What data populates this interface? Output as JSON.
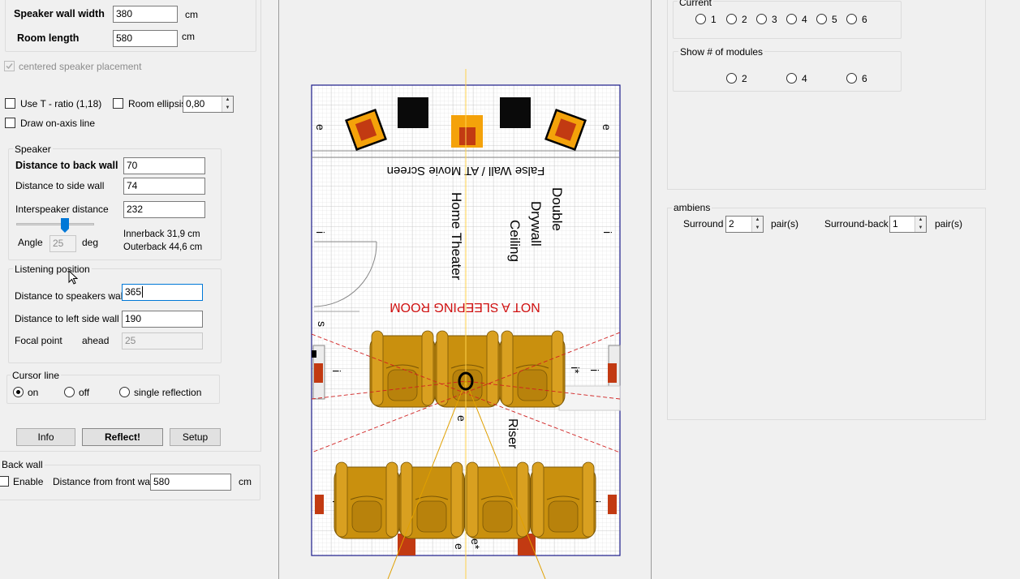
{
  "room": {
    "speaker_wall_width_label": "Speaker wall width",
    "speaker_wall_width_value": "380",
    "room_length_label": "Room length",
    "room_length_value": "580",
    "unit": "cm",
    "centered_label": "centered speaker placement"
  },
  "options": {
    "use_t_ratio_label": "Use T - ratio (1,18)",
    "room_ellipsis_label": "Room ellipsis",
    "room_ellipsis_value": "0,80",
    "draw_on_axis_label": "Draw on-axis line"
  },
  "speaker": {
    "title": "Speaker",
    "dist_back_label": "Distance to back wall",
    "dist_back_value": "70",
    "dist_side_label": "Distance to side wall",
    "dist_side_value": "74",
    "interspeaker_label": "Interspeaker distance",
    "interspeaker_value": "232",
    "angle_label": "Angle",
    "angle_value": "25",
    "angle_unit": "deg",
    "innerback": "Innerback 31,9 cm",
    "outerback": "Outerback 44,6 cm",
    "slider_fraction": 0.62
  },
  "listening": {
    "title": "Listening position",
    "dist_speakers_label": "Distance to speakers wall",
    "dist_speakers_value": "365",
    "dist_left_label": "Distance to left side wall",
    "dist_left_value": "190",
    "focal_label": "Focal point",
    "focal_ahead": "ahead",
    "focal_value": "25"
  },
  "cursor_line": {
    "title": "Cursor line",
    "on": "on",
    "off": "off",
    "single": "single reflection"
  },
  "buttons": {
    "info": "Info",
    "reflect": "Reflect!",
    "setup": "Setup"
  },
  "back_wall": {
    "title": "Back wall",
    "enable_label": "Enable",
    "dist_front_label": "Distance from front wall",
    "dist_front_value": "580",
    "unit": "cm"
  },
  "plan": {
    "screen_text": "False Wall / AT Movie Screen",
    "home_theater": "Home Theater",
    "double": "Double",
    "drywall": "Drywall",
    "ceiling": "Ceiling",
    "not_sleeping": "NOT A SLEEPING ROOM",
    "riser": "Riser",
    "mark_e": "e",
    "mark_i": "i",
    "mark_s": "s",
    "mark_istar": "i*",
    "mark_estar": "e*"
  },
  "current": {
    "title": "Current",
    "options": [
      "1",
      "2",
      "3",
      "4",
      "5",
      "6"
    ]
  },
  "modules": {
    "title": "Show # of modules",
    "options": [
      "2",
      "4",
      "6"
    ]
  },
  "ambiens": {
    "title": "ambiens",
    "surround_label": "Surround",
    "surround_value": "2",
    "surround_back_label": "Surround-back",
    "surround_back_value": "1",
    "pairs": "pair(s)"
  }
}
